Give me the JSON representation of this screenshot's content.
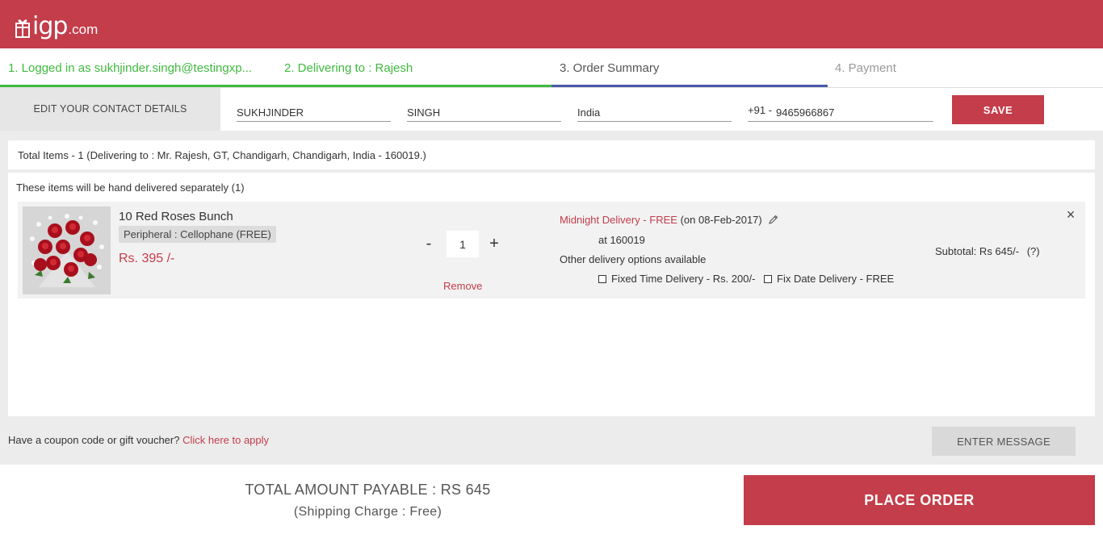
{
  "header": {
    "logo_text": "igp",
    "logo_suffix": ".com",
    "brand_color": "#c33d4a"
  },
  "steps": [
    {
      "label": "1. Logged in as sukhjinder.singh@testingxp...",
      "state": "done"
    },
    {
      "label": "2. Delivering to : Rajesh",
      "state": "done"
    },
    {
      "label": "3. Order Summary",
      "state": "active"
    },
    {
      "label": "4. Payment",
      "state": "todo"
    }
  ],
  "contact": {
    "section_label": "EDIT YOUR CONTACT DETAILS",
    "first_name": "SUKHJINDER",
    "last_name": "SINGH",
    "country": "India",
    "phone_prefix": "+91 -",
    "phone": "9465966867",
    "save_label": "SAVE"
  },
  "summary": {
    "total_items_text": "Total Items - 1 (Delivering to : Mr. Rajesh, GT, Chandigarh, Chandigarh, India - 160019.)"
  },
  "cart": {
    "note": "These items will be hand delivered separately (1)",
    "items": [
      {
        "image_icon": "roses-bouquet-image",
        "name": "10 Red Roses Bunch",
        "peripheral": "Peripheral : Cellophane (FREE)",
        "price": "Rs. 395 /-",
        "qty_minus": "-",
        "qty": "1",
        "qty_plus": "+",
        "remove_label": "Remove",
        "delivery_type": "Midnight Delivery - FREE",
        "delivery_date": "(on 08-Feb-2017)",
        "delivery_at": "at 160019",
        "other_options": "Other delivery options available",
        "option_fixed_time": "Fixed Time Delivery - Rs. 200/-",
        "option_fix_date": "Fix Date Delivery - FREE",
        "subtotal": "Subtotal: Rs 645/-",
        "subtotal_help": "(?)",
        "remove_icon": "×"
      }
    ]
  },
  "coupon": {
    "prompt": "Have a coupon code or gift voucher?",
    "link": "Click here to apply",
    "message_button": "ENTER MESSAGE"
  },
  "footer": {
    "total_payable": "TOTAL AMOUNT PAYABLE : RS 645",
    "shipping": "(Shipping Charge : Free)",
    "place_order": "PLACE ORDER"
  }
}
